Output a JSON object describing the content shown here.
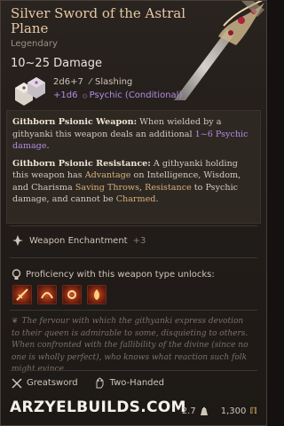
{
  "item": {
    "name": "Silver Sword of the Astral Plane",
    "rarity": "Legendary",
    "damage_summary": "10~25 Damage",
    "damage_lines": [
      {
        "dice": "2d6+7",
        "type": "Slashing"
      },
      {
        "dice": "+1d6",
        "type": "Psychic (Conditional)"
      }
    ]
  },
  "description": {
    "p1_title": "Githborn Psionic Weapon:",
    "p1_a": " When wielded by a githyanki this weapon deals an additional ",
    "p1_hl": "1~6 Psychic damage",
    "p1_end": ".",
    "p2_title": "Githborn Psionic Resistance:",
    "p2_a": " A githyanki holding this weapon has ",
    "p2_k1": "Advantage",
    "p2_b": " on Intelligence, Wisdom, and Charisma ",
    "p2_k2": "Saving Throws",
    "p2_c": ", ",
    "p2_k3": "Resistance",
    "p2_d": " to Psychic damage, and cannot be ",
    "p2_k4": "Charmed",
    "p2_e": "."
  },
  "enchantment": {
    "label": "Weapon Enchantment",
    "value": "+3"
  },
  "proficiency": {
    "label": "Proficiency with this weapon type unlocks:"
  },
  "flavor": "The fervour with which the githyanki express devotion to their queen is admirable to some, disquieting to others. When confronted with the fallibility of the divine (since no one is wholly perfect), who knows what reaction such folk might evince.",
  "properties": [
    {
      "label": "Greatsword",
      "icon": "crossed-swords-icon"
    },
    {
      "label": "Two-Handed",
      "icon": "hand-icon"
    }
  ],
  "footer": {
    "weight": "2.7",
    "value": "1,300"
  },
  "watermark": "ARZYELBUILDS.COM",
  "colors": {
    "title": "#e6c9a4",
    "psychic": "#b28ce2",
    "keyword": "#d6b079",
    "gold": "#d8b25f"
  }
}
